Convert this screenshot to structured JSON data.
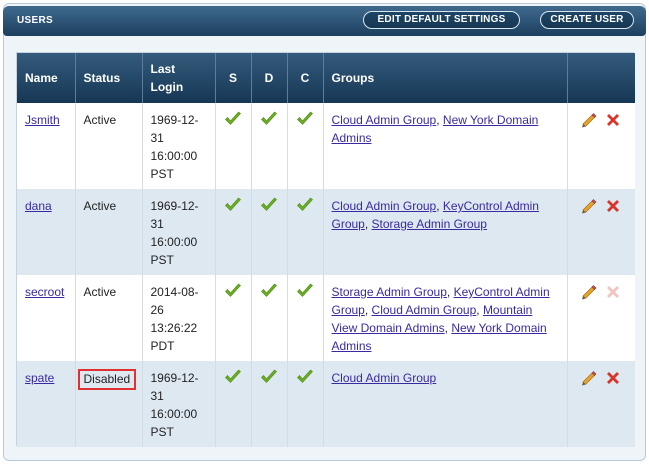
{
  "header": {
    "title": "USERS",
    "edit_default_settings_label": "EDIT DEFAULT SETTINGS",
    "create_user_label": "CREATE USER"
  },
  "columns": {
    "name": "Name",
    "status": "Status",
    "last_login_1": "Last",
    "last_login_2": "Login",
    "s": "S",
    "d": "D",
    "c": "C",
    "groups": "Groups"
  },
  "users": [
    {
      "name": "Jsmith",
      "status": "Active",
      "login_date": "1969-12-",
      "login_day": "31",
      "login_time": "16:00:00",
      "login_tz": "PST",
      "groups": [
        "Cloud Admin Group",
        "New York Domain Admins"
      ],
      "delete_enabled": true
    },
    {
      "name": "dana",
      "status": "Active",
      "login_date": "1969-12-",
      "login_day": "31",
      "login_time": "16:00:00",
      "login_tz": "PST",
      "groups": [
        "Cloud Admin Group",
        "KeyControl Admin Group",
        "Storage Admin Group"
      ],
      "delete_enabled": true
    },
    {
      "name": "secroot",
      "status": "Active",
      "login_date": "2014-08-",
      "login_day": "26",
      "login_time": "13:26:22",
      "login_tz": "PDT",
      "groups": [
        "Storage Admin Group",
        "KeyControl Admin Group",
        "Cloud Admin Group",
        "Mountain View Domain Admins",
        "New York Domain Admins"
      ],
      "delete_enabled": false
    },
    {
      "name": "spate",
      "status": "Disabled",
      "login_date": "1969-12-",
      "login_day": "31",
      "login_time": "16:00:00",
      "login_tz": "PST",
      "groups": [
        "Cloud Admin Group"
      ],
      "delete_enabled": true
    }
  ],
  "colors": {
    "header_dark": "#1c3f5e",
    "check_green": "#6ab023",
    "delete_red": "#d8342a",
    "delete_disabled": "#f0c4c0",
    "link": "#3a2aa0",
    "highlight_border": "#e03030"
  },
  "icons": {
    "check": "check-icon",
    "edit": "pencil-icon",
    "delete": "delete-x-icon"
  }
}
